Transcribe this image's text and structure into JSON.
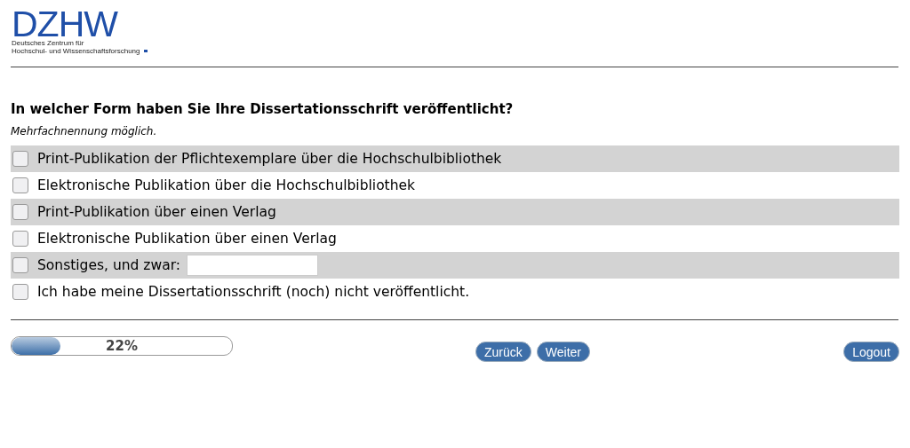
{
  "logo": {
    "wordmark": "DZHW",
    "subtitle_lines": [
      "Deutsches Zentrum für",
      "Hochschul- und Wissenschaftsforschung"
    ]
  },
  "question": {
    "title": "In welcher Form haben Sie Ihre Dissertationsschrift veröffentlicht?",
    "hint": "Mehrfachnennung möglich."
  },
  "options": [
    {
      "kind": "checkbox",
      "label": "Print-Publikation der Pflichtexemplare über die Hochschulbibliothek",
      "checked": false
    },
    {
      "kind": "checkbox",
      "label": "Elektronische Publikation über die Hochschulbibliothek",
      "checked": false
    },
    {
      "kind": "checkbox",
      "label": "Print-Publikation über einen Verlag",
      "checked": false
    },
    {
      "kind": "checkbox",
      "label": "Elektronische Publikation über einen Verlag",
      "checked": false
    },
    {
      "kind": "checkbox_text",
      "label": "Sonstiges, und zwar:",
      "checked": false
    },
    {
      "kind": "checkbox",
      "label": "Ich habe meine Dissertationsschrift (noch) nicht veröffentlicht.",
      "checked": false
    }
  ],
  "progress": {
    "level": 0.22,
    "reading": "22%"
  },
  "nav_buttons": [
    "Zurück",
    "Weiter"
  ],
  "logout_button": "Logout"
}
